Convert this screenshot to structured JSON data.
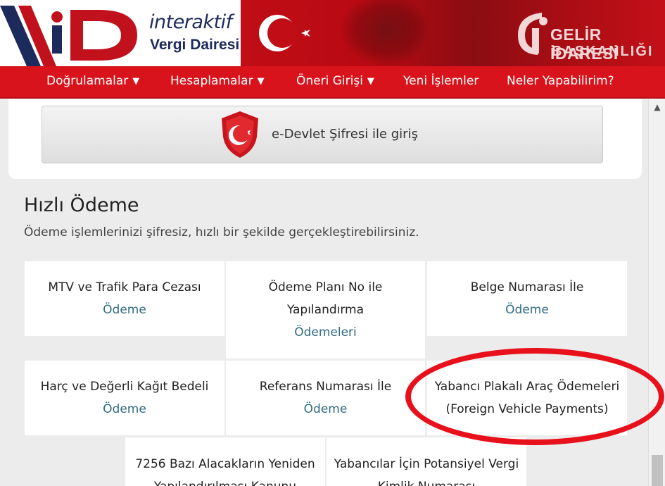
{
  "header": {
    "logo_text_line1": "interaktif",
    "logo_text_line2": "Vergi Dairesi",
    "gib_line1": "GELİR İDARESİ",
    "gib_line2": "BAŞKANLIĞI"
  },
  "nav": {
    "items": [
      {
        "label": "Doğrulamalar",
        "has_dropdown": true
      },
      {
        "label": "Hesaplamalar",
        "has_dropdown": true
      },
      {
        "label": "Öneri Girişi",
        "has_dropdown": true
      },
      {
        "label": "Yeni İşlemler",
        "has_dropdown": false
      },
      {
        "label": "Neler Yapabilirim?",
        "has_dropdown": false
      }
    ],
    "caret": "▼"
  },
  "login": {
    "edevlet_label": "e-Devlet Şifresi ile giriş"
  },
  "quick_payment": {
    "title": "Hızlı Ödeme",
    "subtitle": "Ödeme işlemlerinizi şifresiz, hızlı bir şekilde gerçekleştirebilirsiniz.",
    "tiles": [
      {
        "line1": "MTV ve Trafik Para Cezası",
        "link": "Ödeme"
      },
      {
        "line1": "Ödeme Planı No ile",
        "line2": "Yapılandırma",
        "link": "Ödemeleri"
      },
      {
        "line1": "Belge Numarası İle",
        "link": "Ödeme"
      },
      {
        "line1": "Harç ve Değerli Kağıt Bedeli",
        "link": "Ödeme"
      },
      {
        "line1": "Referans Numarası İle",
        "link": "Ödeme"
      },
      {
        "line1": "Yabancı Plakalı Araç Ödemeleri",
        "line2": "(Foreign Vehicle Payments)"
      },
      {
        "line1": "7256 Bazı Alacakların Yeniden",
        "line2": "Yapılandırılması Kanunu"
      },
      {
        "line1": "Yabancılar İçin Potansiyel Vergi",
        "line2": "Kimlik Numarası"
      }
    ]
  },
  "colors": {
    "nav_red": "#d8131b",
    "link_blue": "#2f6b84",
    "highlight_red": "#e8101a"
  }
}
